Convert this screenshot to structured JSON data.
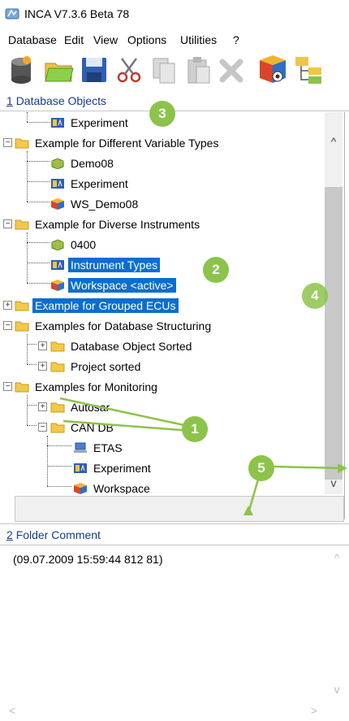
{
  "window": {
    "title": "INCA V7.3.6 Beta 78",
    "icon": "inca-app-icon"
  },
  "menu": {
    "items": [
      {
        "label": "Database"
      },
      {
        "label": "Edit"
      },
      {
        "label": "View"
      },
      {
        "label": "Options"
      },
      {
        "label": "Utilities"
      },
      {
        "label": "?"
      }
    ]
  },
  "toolbar": {
    "buttons": [
      {
        "icon": "database-new-icon"
      },
      {
        "icon": "open-folder-icon"
      },
      {
        "icon": "save-icon"
      },
      {
        "icon": "cut-icon"
      },
      {
        "icon": "copy-icon"
      },
      {
        "icon": "paste-icon"
      },
      {
        "icon": "delete-icon"
      },
      {
        "icon": "workspace-view-icon"
      },
      {
        "icon": "tree-structure-icon"
      }
    ]
  },
  "db_panel": {
    "number": "1",
    "title": "Database Objects"
  },
  "tree": {
    "items": [
      {
        "label": "Experiment",
        "icon": "experiment-icon"
      },
      {
        "label": "Example for Different Variable Types",
        "icon": "folder-icon",
        "expander": "−"
      },
      {
        "label": "Demo08",
        "icon": "device-icon"
      },
      {
        "label": "Experiment",
        "icon": "experiment-icon"
      },
      {
        "label": "WS_Demo08",
        "icon": "workspace-icon"
      },
      {
        "label": "Example for Diverse Instruments",
        "icon": "folder-icon",
        "expander": "−"
      },
      {
        "label": "0400",
        "icon": "device-icon"
      },
      {
        "label": "Instrument Types",
        "icon": "experiment-icon",
        "selected": true
      },
      {
        "label": "Workspace <active>",
        "icon": "workspace-icon",
        "selected": true
      },
      {
        "label": "Example for Grouped ECUs",
        "icon": "folder-icon",
        "expander": "+",
        "selected": true
      },
      {
        "label": "Examples for Database Structuring",
        "icon": "folder-icon",
        "expander": "−"
      },
      {
        "label": "Database Object Sorted",
        "icon": "folder-icon",
        "expander": "+"
      },
      {
        "label": "Project sorted",
        "icon": "folder-icon",
        "expander": "+"
      },
      {
        "label": "Examples for Monitoring",
        "icon": "folder-icon",
        "expander": "−"
      },
      {
        "label": "Autosar",
        "icon": "folder-icon",
        "expander": "+"
      },
      {
        "label": "CAN DB",
        "icon": "folder-icon",
        "expander": "−"
      },
      {
        "label": "ETAS",
        "icon": "hardware-icon"
      },
      {
        "label": "Experiment",
        "icon": "experiment-icon"
      },
      {
        "label": "Workspace",
        "icon": "workspace-icon"
      }
    ]
  },
  "scrollbar": {
    "up": "^",
    "down": "v"
  },
  "comment_panel": {
    "number": "2",
    "title": "Folder Comment",
    "text": "(09.07.2009 15:59:44 812 81)"
  },
  "comment_scroll": {
    "up": "^",
    "down": "v",
    "left": "<",
    "right": ">"
  },
  "callouts": [
    "3",
    "2",
    "4",
    "1",
    "5"
  ],
  "colors": {
    "selection": "#0a6ed1",
    "callout": "#8cc34a",
    "header": "#1a3a8a"
  }
}
